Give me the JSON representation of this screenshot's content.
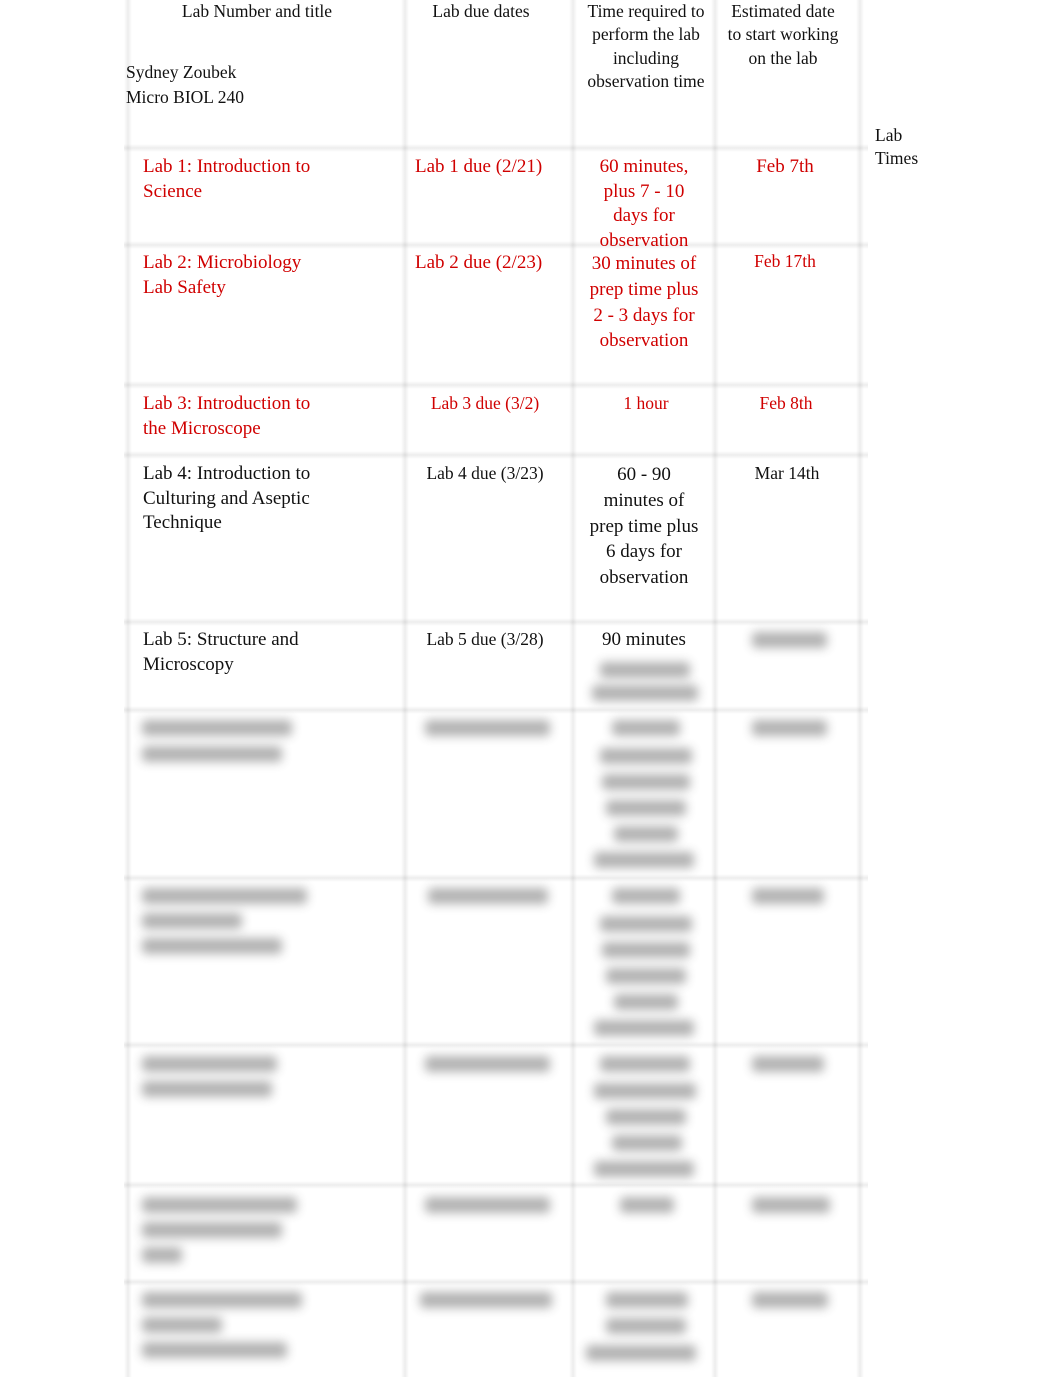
{
  "header": {
    "col_title": "Lab Number and title",
    "col_due": "Lab due dates",
    "col_time": "Time required to perform the lab including observation time",
    "col_start": "Estimated date to start working on the lab",
    "student_name": "Sydney Zoubek",
    "course": "Micro BIOL 240",
    "side_label": "Lab Times"
  },
  "colors": {
    "highlight": "#d00000",
    "text": "#111111"
  },
  "rows": [
    {
      "title": "Lab 1: Introduction to Science",
      "due": "Lab 1 due (2/21)",
      "time": "60 minutes, plus 7 - 10 days for observation",
      "start": "Feb 7th",
      "highlight": true
    },
    {
      "title": "Lab 2: Microbiology Lab Safety",
      "due": "Lab 2 due (2/23)",
      "time": "30 minutes of prep time plus 2 - 3 days for observation",
      "start": "Feb 17th",
      "highlight": true
    },
    {
      "title": "Lab 3: Introduction to the Microscope",
      "due": "Lab 3 due (3/2)",
      "time": "1 hour",
      "start": "Feb 8th",
      "highlight": true
    },
    {
      "title": "Lab 4: Introduction to Culturing and Aseptic Technique",
      "due": "Lab 4 due (3/23)",
      "time": "60 - 90 minutes of prep time plus 6 days for observation",
      "start": "Mar 14th",
      "highlight": false
    },
    {
      "title": "Lab 5: Structure and Microscopy",
      "due": "Lab 5 due (3/28)",
      "time": "90 minutes",
      "start": "",
      "highlight": false
    }
  ]
}
